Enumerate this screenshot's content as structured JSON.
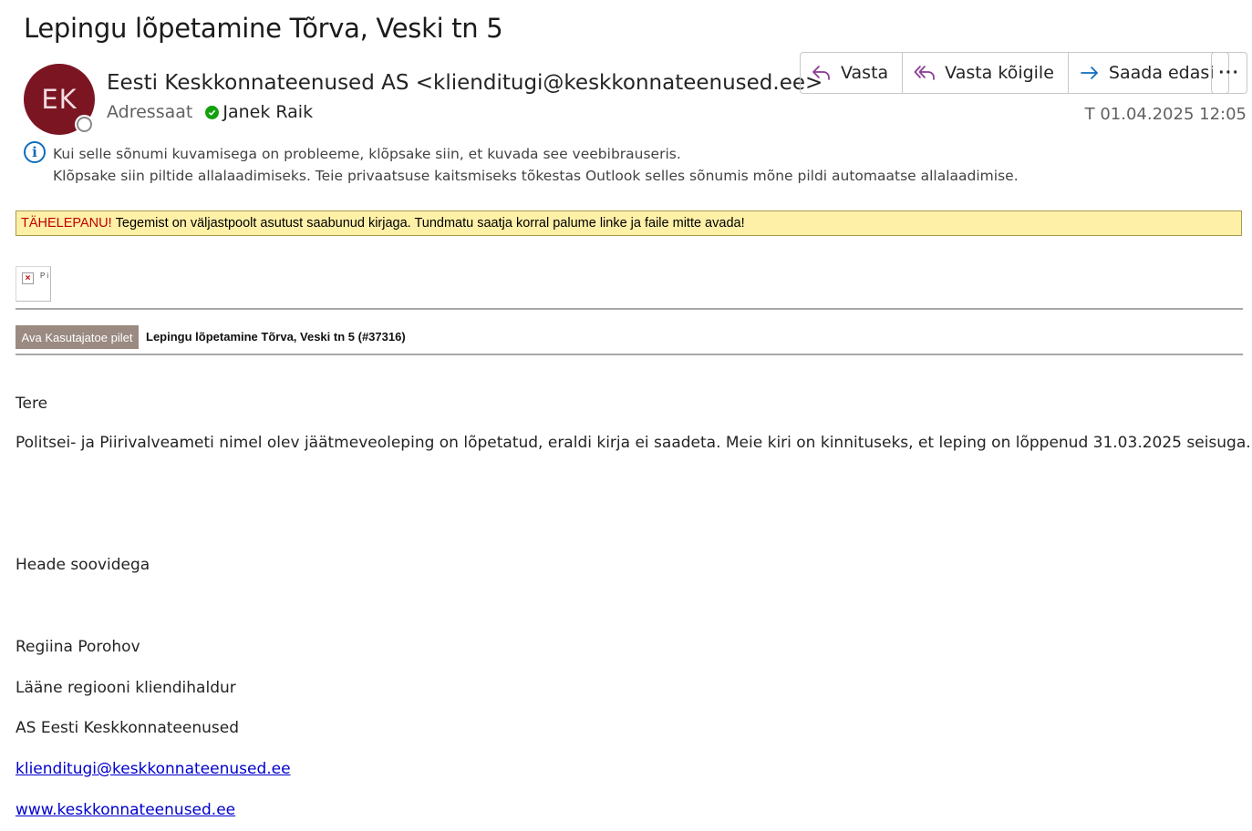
{
  "email": {
    "subject": "Lepingu lõpetamine Tõrva, Veski tn 5",
    "avatar_initials": "EK",
    "avatar_color": "#7b1522",
    "from": "Eesti Keskkonnateenused AS <klienditugi@keskkonnateenused.ee>",
    "to_label": "Adressaat",
    "to_name": "Janek Raik",
    "date": "T 01.04.2025 12:05"
  },
  "actions": {
    "reply": "Vasta",
    "reply_all": "Vasta kõigile",
    "forward": "Saada edasi",
    "more": "···"
  },
  "info": {
    "line1": "Kui selle sõnumi kuvamisega on probleeme, klõpsake siin, et kuvada see veebibrauseris.",
    "line2": "Klõpsake siin piltide allalaadimiseks. Teie privaatsuse kaitsmiseks tõkestas Outlook selles sõnumis mõne pildi automaatse allalaadimise."
  },
  "warning": {
    "label": "TÄHELEPANU!",
    "text": "Tegemist on väljastpoolt asutust saabunud kirjaga. Tundmatu saatja korral palume linke ja faile mitte avada!",
    "bg_color": "#fff0a8",
    "label_color": "#c00000"
  },
  "broken_image_alt": "P i",
  "ticket": {
    "button": "Ava Kasutajatoe pilet",
    "title": "Lepingu lõpetamine Tõrva, Veski tn 5 (#37316)"
  },
  "body": {
    "greeting": "Tere",
    "paragraph": "Politsei- ja Piirivalveameti nimel olev jäätmeveoleping on lõpetatud, eraldi kirja ei saadeta. Meie kiri on kinnituseks, et leping on lõppenud 31.03.2025 seisuga.",
    "closing": "Heade soovidega",
    "sig_name": "Regiina Porohov",
    "sig_title": "Lääne regiooni kliendihaldur",
    "sig_company": "AS Eesti Keskkonnateenused",
    "sig_email": "klienditugi@keskkonnateenused.ee",
    "sig_web": "www.keskkonnateenused.ee"
  }
}
